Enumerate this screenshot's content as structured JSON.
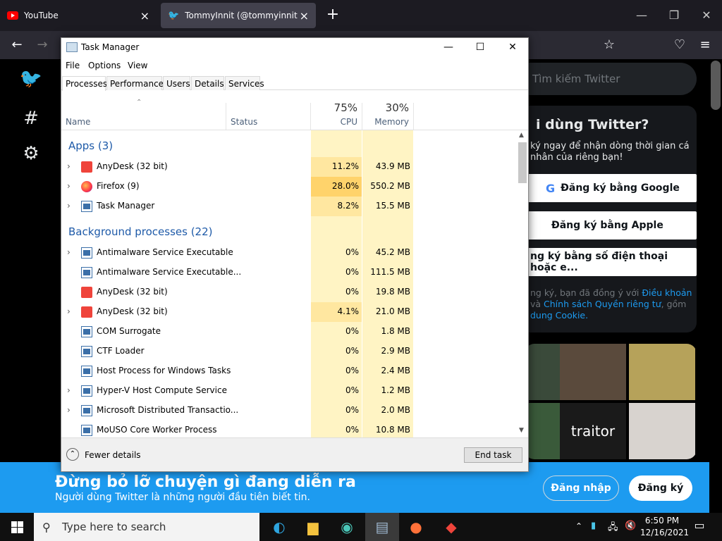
{
  "browser": {
    "tabs": [
      {
        "title": "YouTube",
        "favicon": "youtube-icon"
      },
      {
        "title": "TommyInnit (@tommyinnit) / T",
        "favicon": "twitter-icon"
      }
    ],
    "new_tab": "+",
    "window_controls": {
      "minimize": "—",
      "maximize": "❐",
      "close": "✕"
    },
    "nav": {
      "back": "←",
      "forward": "→",
      "bookmark": "☆",
      "pocket": "♡",
      "menu": "≡"
    }
  },
  "twitter": {
    "search_placeholder": "Tìm kiếm Twitter",
    "signup_title": "i dùng Twitter?",
    "signup_subtitle": "ký ngay để nhận dòng thời gian cá\nnhân của riêng bạn!",
    "google_btn": "Đăng ký bằng Google",
    "apple_btn": "Đăng ký bằng Apple",
    "phone_btn": "ng ký bằng số điện thoại hoặc e...",
    "terms_prefix": "ng ký, bạn đã đồng ý với ",
    "terms_link1": "Điều khoản",
    "terms_mid": " và ",
    "terms_link2": "Chính sách Quyền riêng tư",
    "terms_suffix": ", gồm",
    "terms_link3": "dung Cookie.",
    "photo_caption": "traitor",
    "banner_title": "Đừng bỏ lỡ chuyện gì đang diễn ra",
    "banner_subtitle": "Người dùng Twitter là những người đầu tiên biết tin.",
    "login_label": "Đăng nhập",
    "signup_label": "Đăng ký"
  },
  "task_manager": {
    "title": "Task Manager",
    "menu": [
      "File",
      "Options",
      "View"
    ],
    "tabs": [
      "Processes",
      "Performance",
      "Users",
      "Details",
      "Services"
    ],
    "active_tab": "Processes",
    "columns": {
      "name": "Name",
      "status": "Status",
      "cpu_pct": "75%",
      "cpu": "CPU",
      "mem_pct": "30%",
      "memory": "Memory"
    },
    "groups": {
      "apps": "Apps (3)",
      "background": "Background processes (22)"
    },
    "apps": [
      {
        "name": "AnyDesk (32 bit)",
        "cpu": "11.2%",
        "mem": "43.9 MB",
        "icon": "anydesk-icon",
        "expandable": true
      },
      {
        "name": "Firefox (9)",
        "cpu": "28.0%",
        "mem": "550.2 MB",
        "icon": "firefox-icon",
        "expandable": true
      },
      {
        "name": "Task Manager",
        "cpu": "8.2%",
        "mem": "15.5 MB",
        "icon": "task-manager-icon",
        "expandable": true
      }
    ],
    "background": [
      {
        "name": "Antimalware Service Executable",
        "cpu": "0%",
        "mem": "45.2 MB",
        "icon": "system-process-icon",
        "expandable": true
      },
      {
        "name": "Antimalware Service Executable...",
        "cpu": "0%",
        "mem": "111.5 MB",
        "icon": "system-process-icon",
        "expandable": false
      },
      {
        "name": "AnyDesk (32 bit)",
        "cpu": "0%",
        "mem": "19.8 MB",
        "icon": "anydesk-icon",
        "expandable": false
      },
      {
        "name": "AnyDesk (32 bit)",
        "cpu": "4.1%",
        "mem": "21.0 MB",
        "icon": "anydesk-icon",
        "expandable": true
      },
      {
        "name": "COM Surrogate",
        "cpu": "0%",
        "mem": "1.8 MB",
        "icon": "system-process-icon",
        "expandable": false
      },
      {
        "name": "CTF Loader",
        "cpu": "0%",
        "mem": "2.9 MB",
        "icon": "ctf-loader-icon",
        "expandable": false
      },
      {
        "name": "Host Process for Windows Tasks",
        "cpu": "0%",
        "mem": "2.4 MB",
        "icon": "system-process-icon",
        "expandable": false
      },
      {
        "name": "Hyper-V Host Compute Service",
        "cpu": "0%",
        "mem": "1.2 MB",
        "icon": "system-process-icon",
        "expandable": true
      },
      {
        "name": "Microsoft Distributed Transactio...",
        "cpu": "0%",
        "mem": "2.0 MB",
        "icon": "dtc-icon",
        "expandable": true
      },
      {
        "name": "MoUSO Core Worker Process",
        "cpu": "0%",
        "mem": "10.8 MB",
        "icon": "system-process-icon",
        "expandable": false
      }
    ],
    "fewer_details": "Fewer details",
    "end_task": "End task"
  },
  "taskbar": {
    "search_placeholder": "Type here to search",
    "time": "6:50 PM",
    "date": "12/16/2021"
  },
  "colors": {
    "twitter_blue": "#1d9bf0",
    "cpu_heat_high": "#ffd36b",
    "cpu_heat_low": "#fff4c4",
    "group_blue": "#1e5aa8"
  }
}
